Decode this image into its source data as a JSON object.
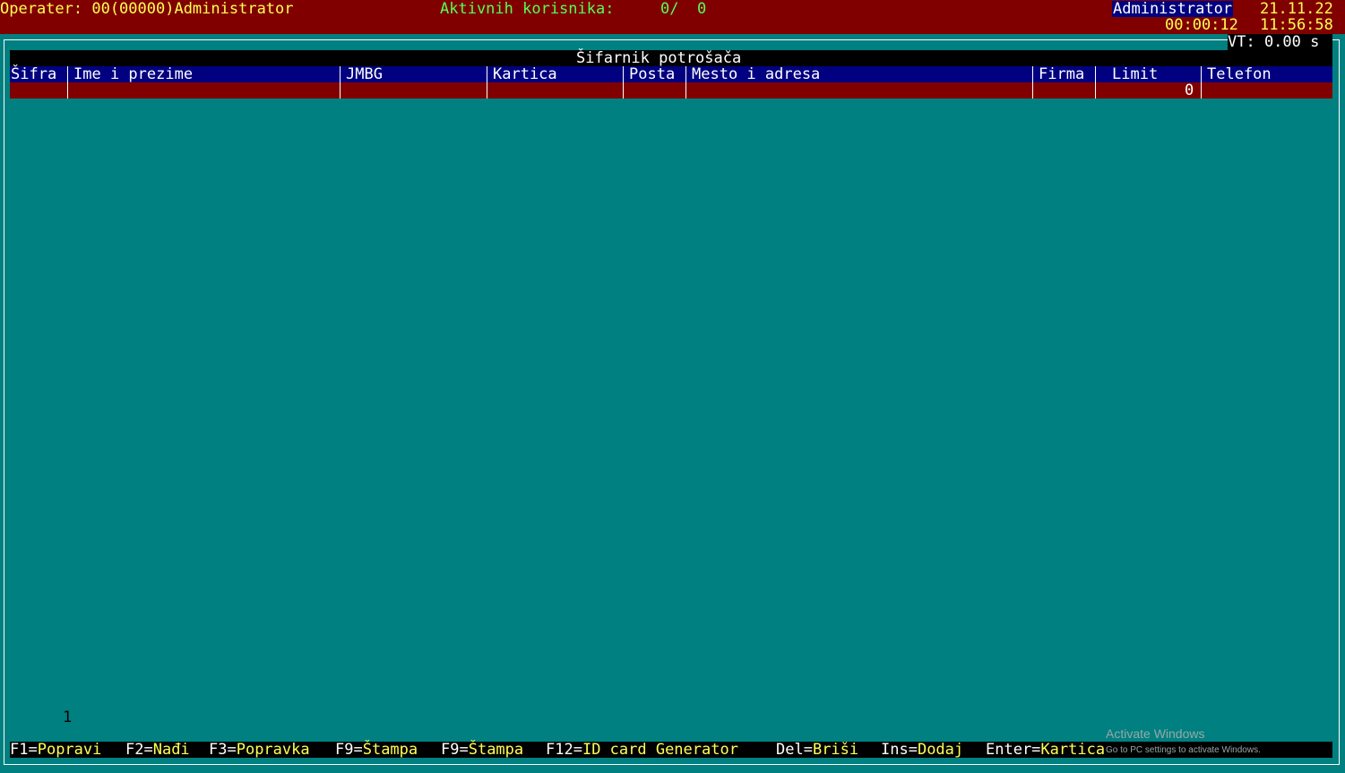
{
  "topbar": {
    "operator": "Operater: 00(00000)Administrator",
    "active_label": "Aktivnih korisnika:",
    "active_count": "0/  0",
    "user_badge": "Administrator",
    "date": "21.11.22",
    "elapsed": "00:00:12",
    "clock": "11:56:58"
  },
  "vt": "VT: 0.00 s",
  "window": {
    "title": "Šifarnik potrošača"
  },
  "table": {
    "columns": [
      "Šifra",
      "Ime i prezime",
      "JMBG",
      "Kartica",
      "Posta",
      "Mesto i adresa",
      "Firma",
      "Limit",
      "Telefon"
    ],
    "rows": [
      {
        "limit": "0"
      }
    ]
  },
  "row_count": "1",
  "fkeys": [
    {
      "key": "F1=",
      "label": "Popravi"
    },
    {
      "key": "F2=",
      "label": "Nađi"
    },
    {
      "key": "F3=",
      "label": "Popravka"
    },
    {
      "key": "F9=",
      "label": "Štampa"
    },
    {
      "key": "F9=",
      "label": "Štampa"
    },
    {
      "key": "F12=",
      "label": "ID card Generator"
    },
    {
      "key": "Del=",
      "label": "Briši"
    },
    {
      "key": "Ins=",
      "label": "Dodaj"
    },
    {
      "key": "Enter=",
      "label": "Kartica"
    }
  ],
  "watermark": {
    "line1": "Activate Windows",
    "line2": "Go to PC settings to activate Windows."
  },
  "colors": {
    "background": "#008080",
    "topbar": "#800000",
    "header": "#000080",
    "row": "#800000",
    "fkey_label": "#ffff55"
  }
}
